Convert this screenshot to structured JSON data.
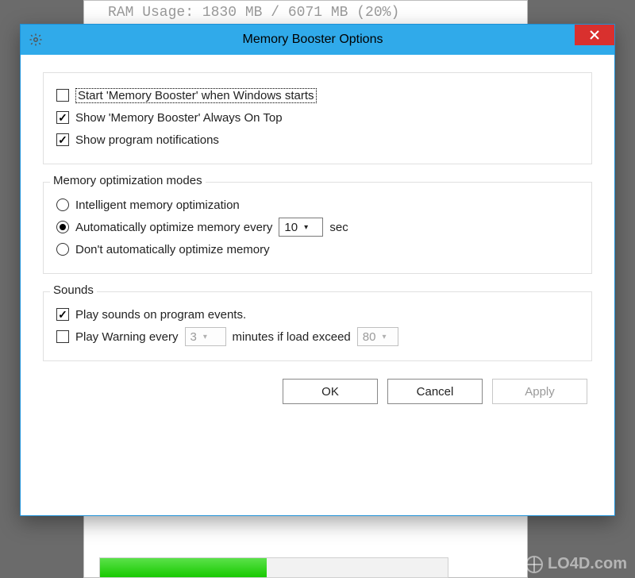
{
  "background": {
    "ram_label": "RAM Usage: 1830 MB / 6071 MB (20%)"
  },
  "dialog": {
    "title": "Memory Booster  Options",
    "close_label": "Close",
    "general": {
      "start_with_windows": {
        "label": "Start 'Memory Booster' when Windows starts",
        "checked": false
      },
      "always_on_top": {
        "label": "Show 'Memory Booster' Always On Top",
        "checked": true
      },
      "notifications": {
        "label": "Show program notifications",
        "checked": true
      }
    },
    "modes": {
      "legend": "Memory optimization modes",
      "intelligent": {
        "label": "Intelligent memory optimization",
        "selected": false
      },
      "auto": {
        "label": "Automatically optimize memory every",
        "selected": true,
        "value": "10",
        "unit": "sec"
      },
      "off": {
        "label": "Don't automatically optimize memory",
        "selected": false
      }
    },
    "sounds": {
      "legend": "Sounds",
      "play_events": {
        "label": "Play sounds on program events.",
        "checked": true
      },
      "play_warning": {
        "label_before": "Play Warning every",
        "minutes": "3",
        "label_mid": "minutes if load exceed",
        "percent": "80",
        "checked": false
      }
    },
    "buttons": {
      "ok": "OK",
      "cancel": "Cancel",
      "apply": "Apply"
    }
  },
  "watermark": "LO4D.com"
}
